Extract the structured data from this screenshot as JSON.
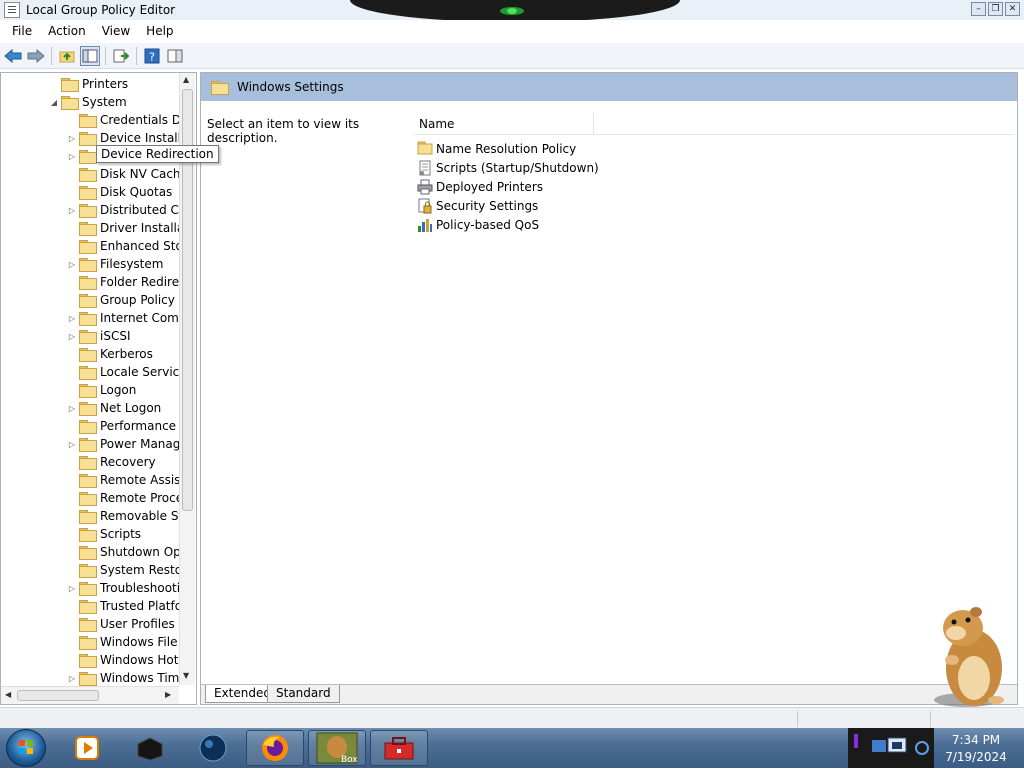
{
  "window": {
    "title": "Local Group Policy Editor"
  },
  "menu": [
    "File",
    "Action",
    "View",
    "Help"
  ],
  "toolbar": {
    "icons": [
      "back-arrow-icon",
      "forward-arrow-icon",
      "up-folder-icon",
      "show-hide-tree-icon",
      "export-list-icon",
      "help-icon",
      "properties-pane-icon"
    ]
  },
  "tree": {
    "items": [
      {
        "label": "Printers",
        "depth": 1,
        "expander": ""
      },
      {
        "label": "System",
        "depth": 1,
        "expander": "expanded"
      },
      {
        "label": "Credentials De",
        "depth": 2,
        "expander": ""
      },
      {
        "label": "Device Installa",
        "depth": 2,
        "expander": "collapsed"
      },
      {
        "label": "Device Redirec",
        "depth": 2,
        "expander": "collapsed"
      },
      {
        "label": "Disk NV Cache",
        "depth": 2,
        "expander": ""
      },
      {
        "label": "Disk Quotas",
        "depth": 2,
        "expander": ""
      },
      {
        "label": "Distributed CC",
        "depth": 2,
        "expander": "collapsed"
      },
      {
        "label": "Driver Installat",
        "depth": 2,
        "expander": ""
      },
      {
        "label": "Enhanced Stor",
        "depth": 2,
        "expander": ""
      },
      {
        "label": "Filesystem",
        "depth": 2,
        "expander": "collapsed"
      },
      {
        "label": "Folder Redirec",
        "depth": 2,
        "expander": ""
      },
      {
        "label": "Group Policy",
        "depth": 2,
        "expander": ""
      },
      {
        "label": "Internet Comr",
        "depth": 2,
        "expander": "collapsed"
      },
      {
        "label": "iSCSI",
        "depth": 2,
        "expander": "collapsed"
      },
      {
        "label": "Kerberos",
        "depth": 2,
        "expander": ""
      },
      {
        "label": "Locale Service",
        "depth": 2,
        "expander": ""
      },
      {
        "label": "Logon",
        "depth": 2,
        "expander": ""
      },
      {
        "label": "Net Logon",
        "depth": 2,
        "expander": "collapsed"
      },
      {
        "label": "Performance C",
        "depth": 2,
        "expander": ""
      },
      {
        "label": "Power Manage",
        "depth": 2,
        "expander": "collapsed"
      },
      {
        "label": "Recovery",
        "depth": 2,
        "expander": ""
      },
      {
        "label": "Remote Assist",
        "depth": 2,
        "expander": ""
      },
      {
        "label": "Remote Proce",
        "depth": 2,
        "expander": ""
      },
      {
        "label": "Removable Stc",
        "depth": 2,
        "expander": ""
      },
      {
        "label": "Scripts",
        "depth": 2,
        "expander": ""
      },
      {
        "label": "Shutdown Opt",
        "depth": 2,
        "expander": ""
      },
      {
        "label": "System Restor",
        "depth": 2,
        "expander": ""
      },
      {
        "label": "Troubleshooti",
        "depth": 2,
        "expander": "collapsed"
      },
      {
        "label": "Trusted Platfo",
        "depth": 2,
        "expander": ""
      },
      {
        "label": "User Profiles",
        "depth": 2,
        "expander": ""
      },
      {
        "label": "Windows File I",
        "depth": 2,
        "expander": ""
      },
      {
        "label": "Windows HotS",
        "depth": 2,
        "expander": ""
      },
      {
        "label": "Windows Time",
        "depth": 2,
        "expander": "collapsed"
      }
    ],
    "tooltip": "Device Redirection"
  },
  "details": {
    "header_title": "Windows Settings",
    "description": "Select an item to view its description.",
    "column_name": "Name",
    "items": [
      {
        "label": "Name Resolution Policy",
        "icon": "folder-icon"
      },
      {
        "label": "Scripts (Startup/Shutdown)",
        "icon": "script-icon"
      },
      {
        "label": "Deployed Printers",
        "icon": "printer-icon"
      },
      {
        "label": "Security Settings",
        "icon": "security-icon"
      },
      {
        "label": "Policy-based QoS",
        "icon": "qos-chart-icon"
      }
    ],
    "tabs": [
      "Extended",
      "Standard"
    ],
    "active_tab": "Extended"
  },
  "taskbar": {
    "apps": [
      "media-player-icon",
      "black-box-app-icon",
      "dark-orb-app-icon",
      "firefox-icon",
      "box-game-icon",
      "red-toolbox-icon"
    ],
    "clock_time": "7:34 PM",
    "clock_date": "7/19/2024"
  }
}
